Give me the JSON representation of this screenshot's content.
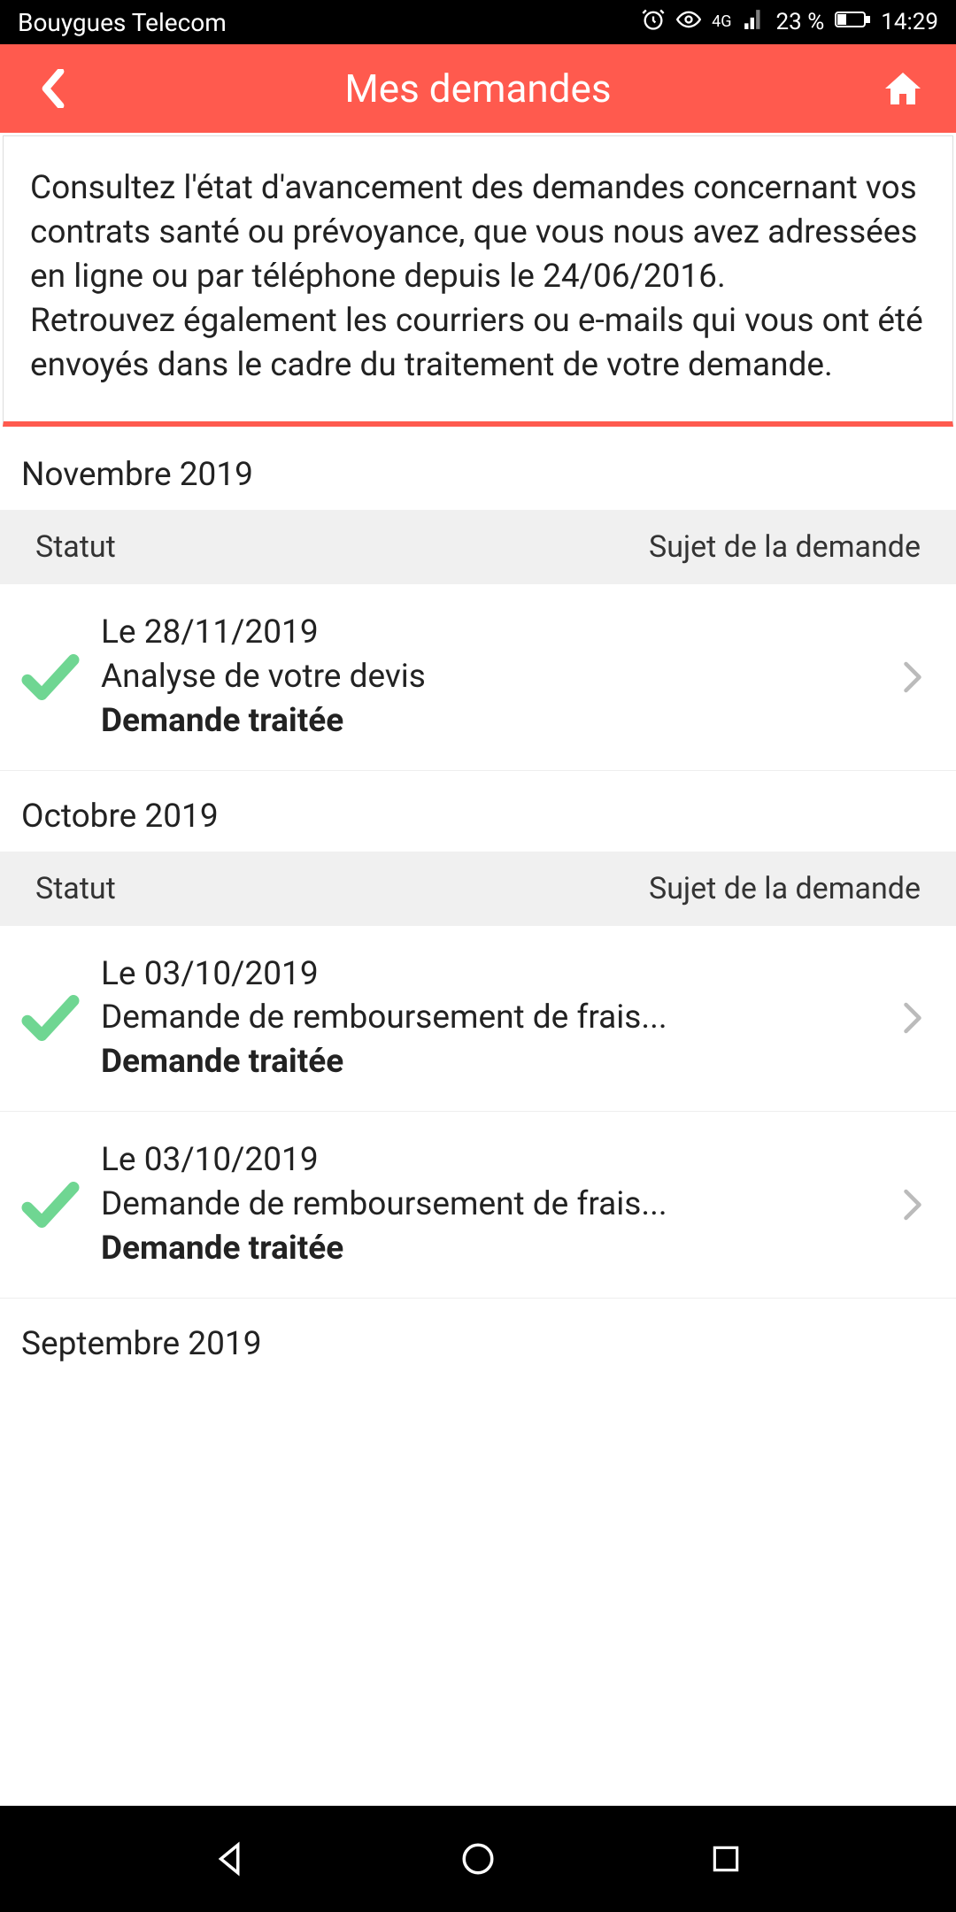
{
  "status": {
    "carrier": "Bouygues Telecom",
    "network": "4G",
    "battery": "23 %",
    "time": "14:29"
  },
  "header": {
    "title": "Mes demandes"
  },
  "intro": {
    "text": "Consultez l'état d'avancement des demandes concernant vos contrats santé ou prévoyance, que vous nous avez adressées en ligne ou par téléphone depuis le 24/06/2016.\nRetrouvez également les courriers ou e-mails qui vous ont été envoyés dans le cadre du traitement de votre demande."
  },
  "tableHeader": {
    "statut": "Statut",
    "sujet": "Sujet de la demande"
  },
  "sections": [
    {
      "month": "Novembre 2019",
      "items": [
        {
          "date": "Le 28/11/2019",
          "subject": "Analyse de votre devis",
          "status": "Demande traitée"
        }
      ]
    },
    {
      "month": "Octobre 2019",
      "items": [
        {
          "date": "Le 03/10/2019",
          "subject": "Demande de remboursement de frais...",
          "status": "Demande traitée"
        },
        {
          "date": "Le 03/10/2019",
          "subject": "Demande de remboursement de frais...",
          "status": "Demande traitée"
        }
      ]
    },
    {
      "month": "Septembre 2019",
      "items": []
    }
  ],
  "colors": {
    "accent": "#ff5a4e",
    "success": "#6fd692"
  }
}
